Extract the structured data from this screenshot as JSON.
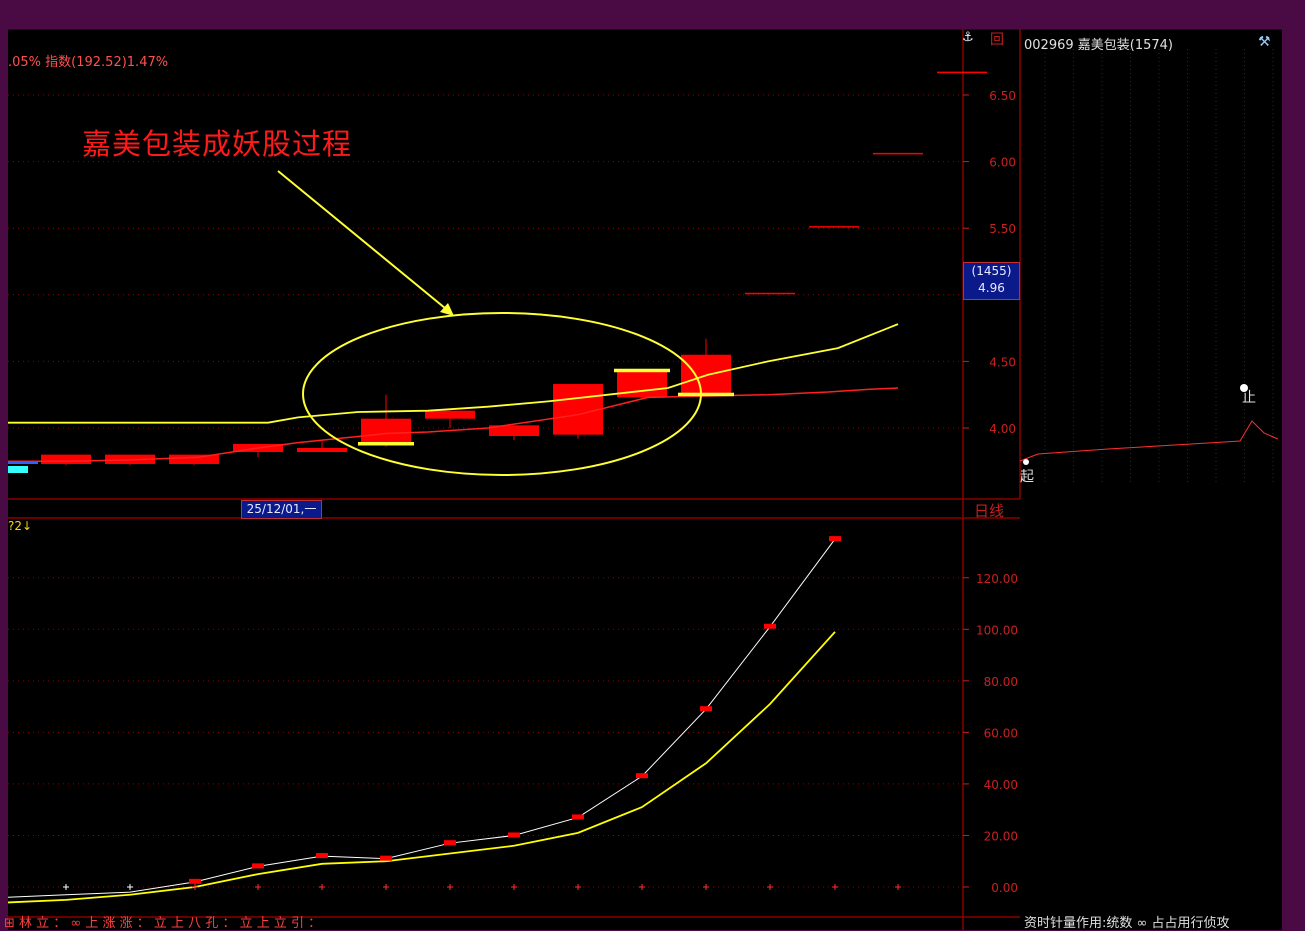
{
  "info_line": ".05% 指数(192.52)1.47%",
  "annotation": "嘉美包装成妖股过程",
  "price_tag": {
    "line1": "(1455)",
    "line2": "4.96"
  },
  "date_tag": "25/12/01,一",
  "period": "日线",
  "top_icons": {
    "anchor": "⚓",
    "square": "回"
  },
  "lower_title": "?2↓",
  "side_panel": {
    "title": "002969 嘉美包装(1574)",
    "icon": "⚒",
    "start_label": "起",
    "stop_label": "止"
  },
  "bottom_text_left": "⊞ 林 立 ： ∞ 上 涨 涨 ： 立 上 八 孔 ： 立 上 立 引 ：",
  "bottom_text_right": "资时针量作用:统数 ∞ 占占用行侦攻",
  "colors": {
    "up": "#ff0000",
    "ma_fast": "#ffff33",
    "ma_slow": "#ff2020",
    "grid": "#8b0000",
    "axis_text": "#c82020",
    "highlight_ellipse": "#ffff33",
    "curve_white": "#ffffff",
    "curve_yellow": "#ffff00"
  },
  "chart_data": [
    {
      "type": "candlestick",
      "yticks": [
        "4.00",
        "4.50",
        "5.00",
        "5.50",
        "6.00",
        "6.50"
      ],
      "ylim": [
        3.5,
        7.0
      ],
      "candles": [
        {
          "o": 3.73,
          "h": 3.78,
          "l": 3.72,
          "c": 3.8,
          "body": "flat"
        },
        {
          "o": 3.73,
          "h": 3.79,
          "l": 3.72,
          "c": 3.8
        },
        {
          "o": 3.73,
          "h": 3.79,
          "l": 3.72,
          "c": 3.8
        },
        {
          "o": 3.82,
          "h": 3.88,
          "l": 3.78,
          "c": 3.88
        },
        {
          "o": 3.85,
          "h": 3.9,
          "l": 3.84,
          "c": 3.85
        },
        {
          "o": 3.88,
          "h": 4.25,
          "l": 3.86,
          "c": 4.07
        },
        {
          "o": 4.07,
          "h": 4.13,
          "l": 4.0,
          "c": 4.13
        },
        {
          "o": 3.94,
          "h": 4.02,
          "l": 3.91,
          "c": 4.02
        },
        {
          "o": 3.95,
          "h": 4.33,
          "l": 3.92,
          "c": 4.33
        },
        {
          "o": 4.23,
          "h": 4.43,
          "l": 4.22,
          "c": 4.43
        },
        {
          "o": 4.25,
          "h": 4.67,
          "l": 4.24,
          "c": 4.55
        },
        {
          "o": 5.01,
          "h": 5.01,
          "l": 5.01,
          "c": 5.01
        },
        {
          "o": 5.51,
          "h": 5.51,
          "l": 5.51,
          "c": 5.51
        },
        {
          "o": 6.06,
          "h": 6.06,
          "l": 6.06,
          "c": 6.06
        },
        {
          "o": 6.67,
          "h": 6.67,
          "l": 6.67,
          "c": 6.67
        }
      ],
      "ma_fast": [
        4.04,
        4.04,
        4.04,
        4.04,
        4.04,
        4.08,
        4.12,
        4.13,
        4.16,
        4.2,
        4.25,
        4.3,
        4.4,
        4.5,
        4.6,
        4.78
      ],
      "ma_slow": [
        3.75,
        3.75,
        3.76,
        3.78,
        3.85,
        3.89,
        3.96,
        3.97,
        4.0,
        4.1,
        4.23,
        4.24,
        4.25,
        4.27,
        4.29,
        4.3
      ]
    },
    {
      "type": "line",
      "yticks": [
        "0.00",
        "20.00",
        "40.00",
        "60.00",
        "80.00",
        "100.00",
        "120.00"
      ],
      "ylim": [
        -10,
        137
      ],
      "series": [
        {
          "values": [
            -4,
            -3,
            -2,
            2,
            8,
            12,
            11,
            17,
            20,
            27,
            43,
            69,
            101,
            135
          ]
        },
        {
          "values": [
            -6,
            -5,
            -3,
            0,
            5,
            9,
            10,
            13,
            16,
            21,
            31,
            48,
            71,
            99
          ]
        }
      ]
    }
  ]
}
